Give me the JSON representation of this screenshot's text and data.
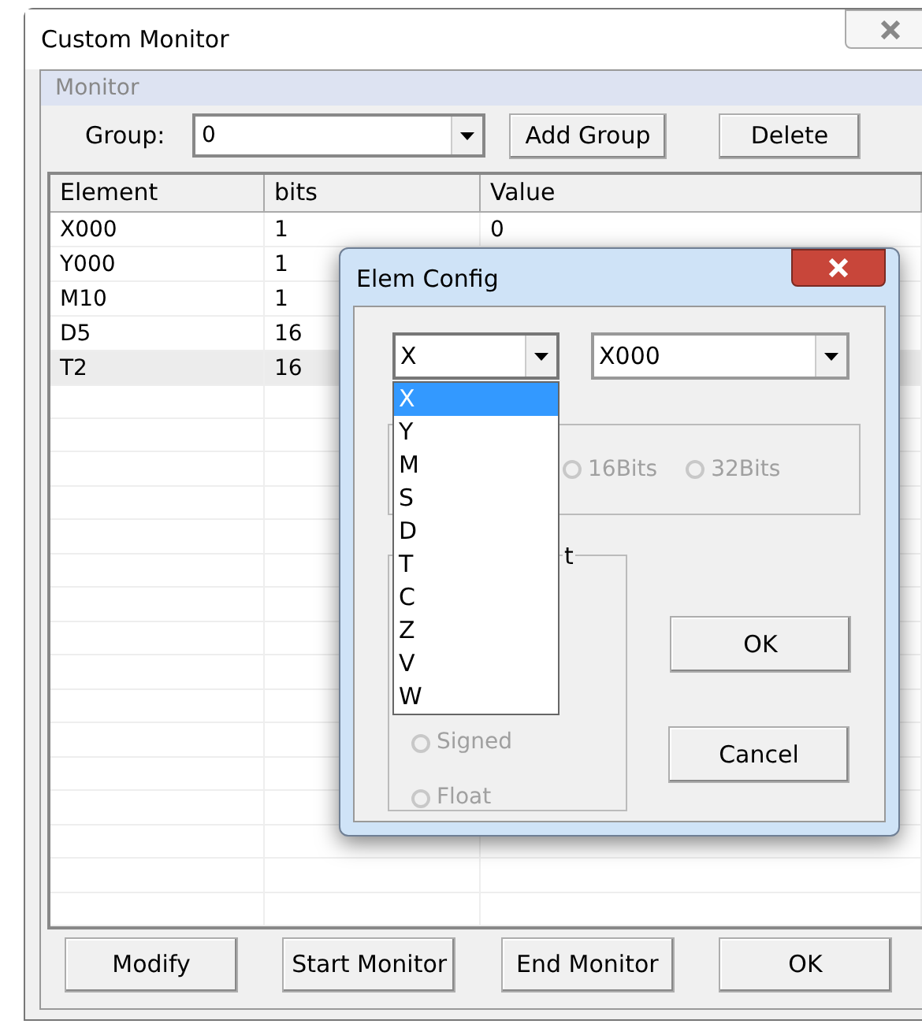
{
  "window": {
    "title": "Custom Monitor"
  },
  "panel": {
    "title": "Monitor"
  },
  "group": {
    "label": "Group:",
    "value": "0"
  },
  "toolbar_buttons": [
    "Add Group",
    "Delete"
  ],
  "table": {
    "columns": [
      "Element",
      "bits",
      "Value"
    ],
    "rows": [
      {
        "cells": [
          "X000",
          "1",
          "0"
        ],
        "selected": false
      },
      {
        "cells": [
          "Y000",
          "1"
        ],
        "selected": false
      },
      {
        "cells": [
          "M10",
          "1"
        ],
        "selected": false
      },
      {
        "cells": [
          "D5",
          "16"
        ],
        "selected": false
      },
      {
        "cells": [
          "T2",
          "16"
        ],
        "selected": true
      }
    ]
  },
  "bottom_buttons": [
    "Modify",
    "Start Monitor",
    "End Monitor",
    "OK"
  ],
  "dialog": {
    "title": "Elem Config",
    "type_combo": {
      "value": "X",
      "expanded": true,
      "options": [
        {
          "label": "X",
          "selected": true
        },
        {
          "label": "Y",
          "selected": false
        },
        {
          "label": "M",
          "selected": false
        },
        {
          "label": "S",
          "selected": false
        },
        {
          "label": "D",
          "selected": false
        },
        {
          "label": "T",
          "selected": false
        },
        {
          "label": "C",
          "selected": false
        },
        {
          "label": "Z",
          "selected": false
        },
        {
          "label": "V",
          "selected": false
        },
        {
          "label": "W",
          "selected": false
        }
      ]
    },
    "address_combo": {
      "value": "X000"
    },
    "bits_radios": [
      {
        "label": "16Bits",
        "disabled": true
      },
      {
        "label": "32Bits",
        "disabled": true
      }
    ],
    "format_group": {
      "legend": "t",
      "radios": [
        {
          "label": "Signed",
          "disabled": true
        },
        {
          "label": "Float",
          "disabled": true
        }
      ]
    },
    "buttons": [
      "OK",
      "Cancel"
    ]
  }
}
